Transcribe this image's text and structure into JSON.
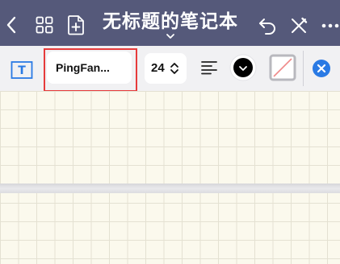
{
  "header": {
    "title": "无标题的笔记本",
    "icons": [
      "back-icon",
      "grid-icon",
      "add-page-icon",
      "title-dropdown-icon",
      "undo-icon",
      "tools-icon",
      "more-icon"
    ]
  },
  "toolbar": {
    "text_mode_icon": "T",
    "font_name": "PingFan...",
    "font_size": "24",
    "text_color": "#000000",
    "icons": [
      "text-box-icon",
      "stepper-icon",
      "align-left-icon",
      "color-picker-icon",
      "no-fill-icon",
      "close-icon"
    ]
  },
  "colors": {
    "nav_bg": "#55597a",
    "accent": "#2a7ae4",
    "highlight": "#e63b3b",
    "paper": "#fbf9ed",
    "grid": "#e4e1d2"
  }
}
